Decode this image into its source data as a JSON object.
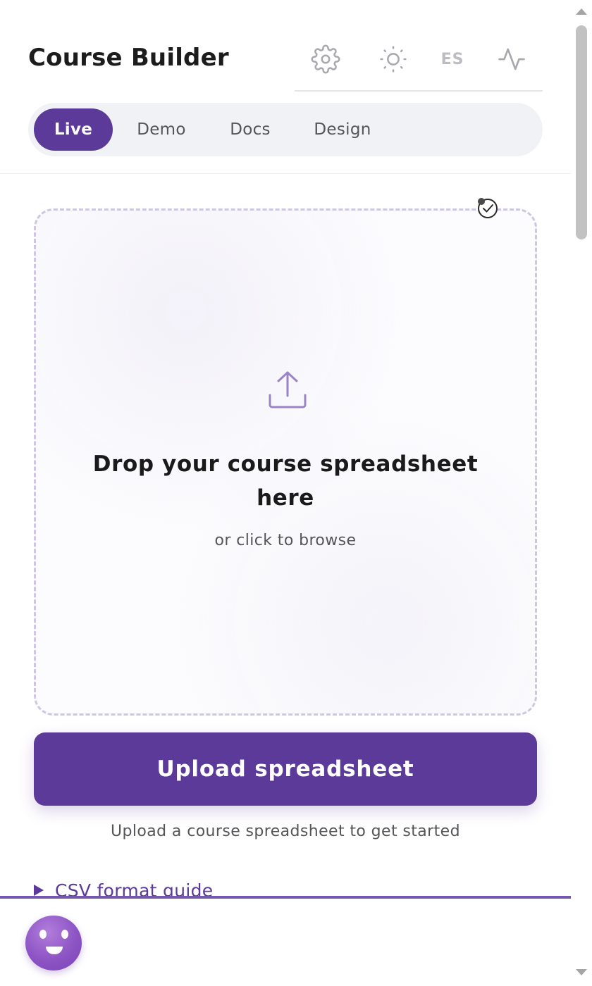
{
  "header": {
    "title": "Course Builder",
    "toolbar": {
      "settings_icon": "gear-icon",
      "theme_icon": "sun-icon",
      "language": "ES",
      "activity_icon": "activity-icon"
    },
    "tabs": [
      {
        "label": "Live",
        "active": true
      },
      {
        "label": "Demo",
        "active": false
      },
      {
        "label": "Docs",
        "active": false
      },
      {
        "label": "Design",
        "active": false
      }
    ]
  },
  "main": {
    "dropzone": {
      "status_icon": "check-circle-icon",
      "icon": "upload-icon",
      "title": "Drop your course spreadsheet here",
      "subtitle": "or click to browse"
    },
    "upload_button": "Upload spreadsheet",
    "hint": "Upload a course spreadsheet to get started",
    "csv_guide": "CSV format guide"
  },
  "assistant": {
    "icon": "smiley-avatar-icon"
  },
  "colors": {
    "accent": "#5b3a9a",
    "dropzone_border": "#cfc6e6",
    "tab_bar_bg": "#f1f2f6",
    "muted_text": "#555558",
    "avatar": "#8d54c4"
  }
}
